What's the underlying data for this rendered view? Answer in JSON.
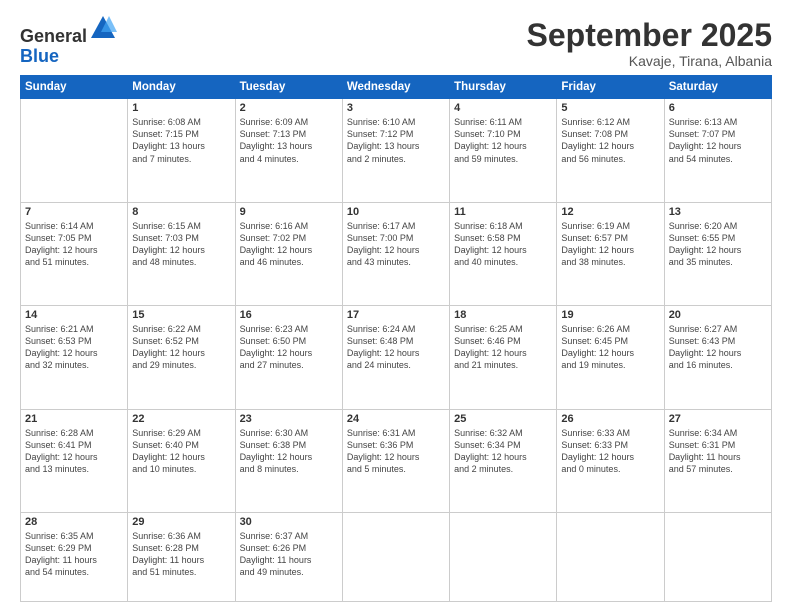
{
  "logo": {
    "general": "General",
    "blue": "Blue"
  },
  "title": "September 2025",
  "location": "Kavaje, Tirana, Albania",
  "days_header": [
    "Sunday",
    "Monday",
    "Tuesday",
    "Wednesday",
    "Thursday",
    "Friday",
    "Saturday"
  ],
  "weeks": [
    [
      {
        "num": "",
        "info": ""
      },
      {
        "num": "1",
        "info": "Sunrise: 6:08 AM\nSunset: 7:15 PM\nDaylight: 13 hours\nand 7 minutes."
      },
      {
        "num": "2",
        "info": "Sunrise: 6:09 AM\nSunset: 7:13 PM\nDaylight: 13 hours\nand 4 minutes."
      },
      {
        "num": "3",
        "info": "Sunrise: 6:10 AM\nSunset: 7:12 PM\nDaylight: 13 hours\nand 2 minutes."
      },
      {
        "num": "4",
        "info": "Sunrise: 6:11 AM\nSunset: 7:10 PM\nDaylight: 12 hours\nand 59 minutes."
      },
      {
        "num": "5",
        "info": "Sunrise: 6:12 AM\nSunset: 7:08 PM\nDaylight: 12 hours\nand 56 minutes."
      },
      {
        "num": "6",
        "info": "Sunrise: 6:13 AM\nSunset: 7:07 PM\nDaylight: 12 hours\nand 54 minutes."
      }
    ],
    [
      {
        "num": "7",
        "info": "Sunrise: 6:14 AM\nSunset: 7:05 PM\nDaylight: 12 hours\nand 51 minutes."
      },
      {
        "num": "8",
        "info": "Sunrise: 6:15 AM\nSunset: 7:03 PM\nDaylight: 12 hours\nand 48 minutes."
      },
      {
        "num": "9",
        "info": "Sunrise: 6:16 AM\nSunset: 7:02 PM\nDaylight: 12 hours\nand 46 minutes."
      },
      {
        "num": "10",
        "info": "Sunrise: 6:17 AM\nSunset: 7:00 PM\nDaylight: 12 hours\nand 43 minutes."
      },
      {
        "num": "11",
        "info": "Sunrise: 6:18 AM\nSunset: 6:58 PM\nDaylight: 12 hours\nand 40 minutes."
      },
      {
        "num": "12",
        "info": "Sunrise: 6:19 AM\nSunset: 6:57 PM\nDaylight: 12 hours\nand 38 minutes."
      },
      {
        "num": "13",
        "info": "Sunrise: 6:20 AM\nSunset: 6:55 PM\nDaylight: 12 hours\nand 35 minutes."
      }
    ],
    [
      {
        "num": "14",
        "info": "Sunrise: 6:21 AM\nSunset: 6:53 PM\nDaylight: 12 hours\nand 32 minutes."
      },
      {
        "num": "15",
        "info": "Sunrise: 6:22 AM\nSunset: 6:52 PM\nDaylight: 12 hours\nand 29 minutes."
      },
      {
        "num": "16",
        "info": "Sunrise: 6:23 AM\nSunset: 6:50 PM\nDaylight: 12 hours\nand 27 minutes."
      },
      {
        "num": "17",
        "info": "Sunrise: 6:24 AM\nSunset: 6:48 PM\nDaylight: 12 hours\nand 24 minutes."
      },
      {
        "num": "18",
        "info": "Sunrise: 6:25 AM\nSunset: 6:46 PM\nDaylight: 12 hours\nand 21 minutes."
      },
      {
        "num": "19",
        "info": "Sunrise: 6:26 AM\nSunset: 6:45 PM\nDaylight: 12 hours\nand 19 minutes."
      },
      {
        "num": "20",
        "info": "Sunrise: 6:27 AM\nSunset: 6:43 PM\nDaylight: 12 hours\nand 16 minutes."
      }
    ],
    [
      {
        "num": "21",
        "info": "Sunrise: 6:28 AM\nSunset: 6:41 PM\nDaylight: 12 hours\nand 13 minutes."
      },
      {
        "num": "22",
        "info": "Sunrise: 6:29 AM\nSunset: 6:40 PM\nDaylight: 12 hours\nand 10 minutes."
      },
      {
        "num": "23",
        "info": "Sunrise: 6:30 AM\nSunset: 6:38 PM\nDaylight: 12 hours\nand 8 minutes."
      },
      {
        "num": "24",
        "info": "Sunrise: 6:31 AM\nSunset: 6:36 PM\nDaylight: 12 hours\nand 5 minutes."
      },
      {
        "num": "25",
        "info": "Sunrise: 6:32 AM\nSunset: 6:34 PM\nDaylight: 12 hours\nand 2 minutes."
      },
      {
        "num": "26",
        "info": "Sunrise: 6:33 AM\nSunset: 6:33 PM\nDaylight: 12 hours\nand 0 minutes."
      },
      {
        "num": "27",
        "info": "Sunrise: 6:34 AM\nSunset: 6:31 PM\nDaylight: 11 hours\nand 57 minutes."
      }
    ],
    [
      {
        "num": "28",
        "info": "Sunrise: 6:35 AM\nSunset: 6:29 PM\nDaylight: 11 hours\nand 54 minutes."
      },
      {
        "num": "29",
        "info": "Sunrise: 6:36 AM\nSunset: 6:28 PM\nDaylight: 11 hours\nand 51 minutes."
      },
      {
        "num": "30",
        "info": "Sunrise: 6:37 AM\nSunset: 6:26 PM\nDaylight: 11 hours\nand 49 minutes."
      },
      {
        "num": "",
        "info": ""
      },
      {
        "num": "",
        "info": ""
      },
      {
        "num": "",
        "info": ""
      },
      {
        "num": "",
        "info": ""
      }
    ]
  ]
}
